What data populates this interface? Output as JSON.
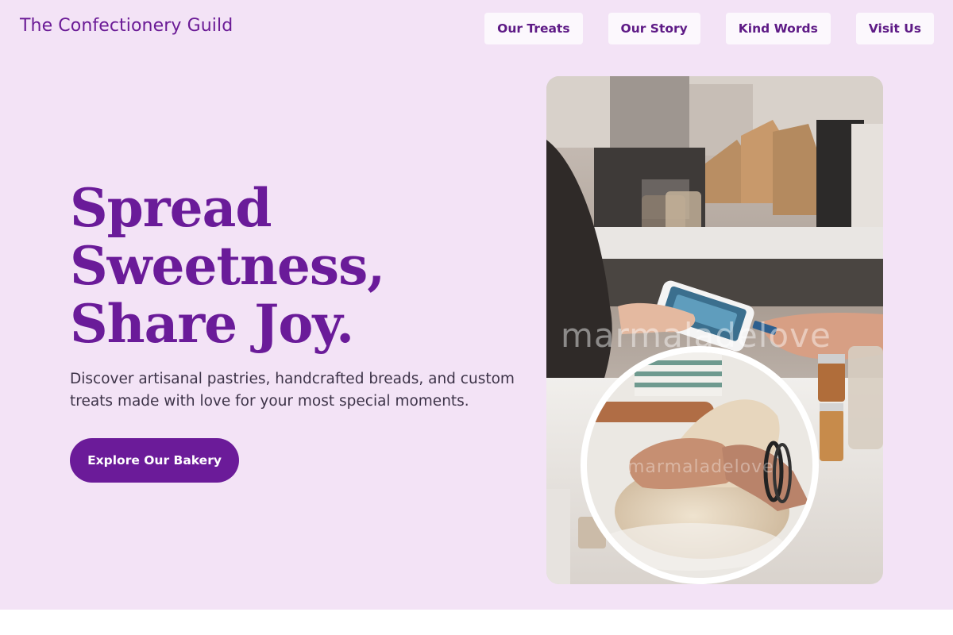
{
  "brand": {
    "name": "The Confectionery Guild"
  },
  "nav": {
    "items": [
      {
        "label": "Our Treats"
      },
      {
        "label": "Our Story"
      },
      {
        "label": "Kind Words"
      },
      {
        "label": "Visit Us"
      }
    ]
  },
  "hero": {
    "headline": "Spread Sweetness, Share Joy.",
    "subtitle": "Discover artisanal pastries, handcrafted breads, and custom treats made with love for your most special moments.",
    "cta_label": "Explore Our Bakery",
    "main_image": {
      "subject": "bakery-counter-card-payment-photo",
      "watermark": "marmaladelove"
    },
    "inset_image": {
      "subject": "hands-kneading-dough-photo",
      "watermark": "marmaladelove"
    }
  },
  "colors": {
    "page_background": "#f3e3f6",
    "accent": "#6b1b99",
    "nav_button_background": "#fcf8fd",
    "body_text": "#3d3348"
  }
}
